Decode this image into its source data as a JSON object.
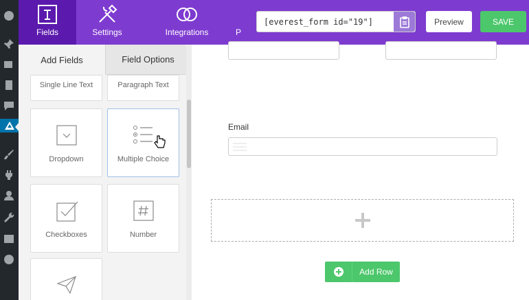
{
  "header": {
    "tabs": [
      {
        "label": "Fields",
        "icon": "fields-form-icon",
        "active": true
      },
      {
        "label": "Settings",
        "icon": "settings-tools-icon",
        "active": false
      },
      {
        "label": "Integrations",
        "icon": "integrations-rings-icon",
        "active": false
      },
      {
        "label": "P",
        "icon": "",
        "active": false
      }
    ],
    "shortcode": "[everest_form id=\"19\"]",
    "copy_icon": "clipboard-icon",
    "preview_label": "Preview",
    "save_label": "SAVE",
    "colors": {
      "bar": "#7e3bd0",
      "active_tab": "#5b1aad",
      "save": "#4cc76b"
    }
  },
  "panel": {
    "tabs": [
      "Add Fields",
      "Field Options"
    ],
    "fields": [
      {
        "label": "Single Line Text"
      },
      {
        "label": "Paragraph Text"
      },
      {
        "label": "Dropdown",
        "icon": "dropdown-icon"
      },
      {
        "label": "Multiple Choice",
        "icon": "multiple-choice-icon"
      },
      {
        "label": "Checkboxes",
        "icon": "checkbox-icon"
      },
      {
        "label": "Number",
        "icon": "number-hash-icon"
      },
      {
        "label": "",
        "icon": "paper-plane-icon"
      }
    ]
  },
  "canvas": {
    "email_label": "Email",
    "add_row_label": "Add Row"
  }
}
